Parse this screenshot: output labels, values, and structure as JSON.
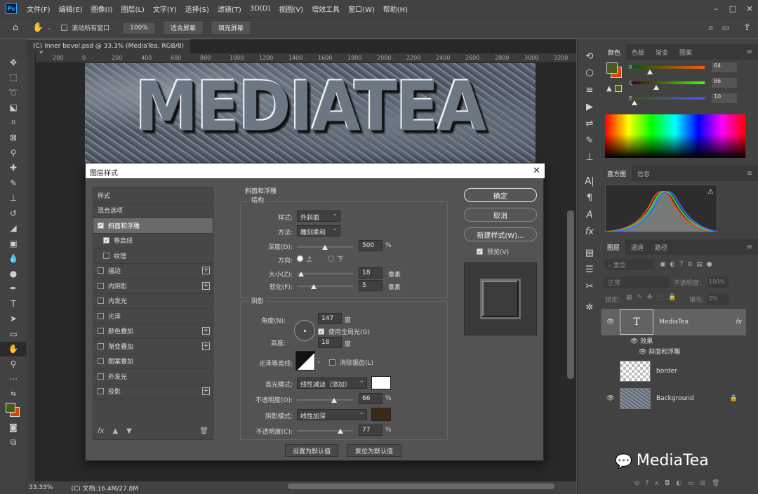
{
  "menu": {
    "items": [
      "文件(F)",
      "编辑(E)",
      "图像(I)",
      "图层(L)",
      "文字(Y)",
      "选择(S)",
      "滤镜(T)",
      "3D(D)",
      "视图(V)",
      "增效工具",
      "窗口(W)",
      "帮助(H)"
    ]
  },
  "options": {
    "scroll_all": "滚动所有窗口",
    "zoom_100": "100%",
    "fit_screen": "适合屏幕",
    "fill_screen": "填充屏幕"
  },
  "document": {
    "tab_title": "(C) Inner bevel.psd @ 33.3% (MediaTea, RGB/8)",
    "ruler_ticks": [
      "200",
      "0",
      "200",
      "400",
      "600",
      "800",
      "1000",
      "1200",
      "1400",
      "1600",
      "1800",
      "2000",
      "2200",
      "2400",
      "2600",
      "2800",
      "3000",
      "3200"
    ],
    "canvas_text": "MEDIATEA",
    "zoom": "33.33%",
    "doc_info": "(C) 文档:16.4M/27.8M"
  },
  "dialog": {
    "title": "图层样式",
    "styles_header": "样式",
    "blend_options": "混合选项",
    "effects": [
      {
        "label": "斜面和浮雕",
        "checked": true,
        "selected": true,
        "plus": false,
        "indent": false
      },
      {
        "label": "等高线",
        "checked": true,
        "selected": false,
        "plus": false,
        "indent": true
      },
      {
        "label": "纹理",
        "checked": false,
        "selected": false,
        "plus": false,
        "indent": true
      },
      {
        "label": "描边",
        "checked": false,
        "selected": false,
        "plus": true,
        "indent": false
      },
      {
        "label": "内阴影",
        "checked": false,
        "selected": false,
        "plus": true,
        "indent": false
      },
      {
        "label": "内发光",
        "checked": false,
        "selected": false,
        "plus": false,
        "indent": false
      },
      {
        "label": "光泽",
        "checked": false,
        "selected": false,
        "plus": false,
        "indent": false
      },
      {
        "label": "颜色叠加",
        "checked": false,
        "selected": false,
        "plus": true,
        "indent": false
      },
      {
        "label": "渐变叠加",
        "checked": false,
        "selected": false,
        "plus": true,
        "indent": false
      },
      {
        "label": "图案叠加",
        "checked": false,
        "selected": false,
        "plus": false,
        "indent": false
      },
      {
        "label": "外发光",
        "checked": false,
        "selected": false,
        "plus": false,
        "indent": false
      },
      {
        "label": "投影",
        "checked": false,
        "selected": false,
        "plus": true,
        "indent": false
      }
    ],
    "section_title": "斜面和浮雕",
    "structure": {
      "title": "结构",
      "style_label": "样式:",
      "style_value": "外斜面",
      "technique_label": "方法:",
      "technique_value": "雕刻柔和",
      "depth_label": "深度(D):",
      "depth_value": "500",
      "depth_unit": "%",
      "depth_fraction": 0.5,
      "direction_label": "方向:",
      "dir_up": "上",
      "dir_down": "下",
      "size_label": "大小(Z):",
      "size_value": "18",
      "size_unit": "像素",
      "size_fraction": 0.07,
      "soften_label": "软化(F):",
      "soften_value": "5",
      "soften_unit": "像素",
      "soften_fraction": 0.3
    },
    "shading": {
      "title": "阴影",
      "angle_label": "角度(N):",
      "angle_value": "147",
      "angle_unit": "度",
      "global_light": "使用全局光(G)",
      "altitude_label": "高度:",
      "altitude_value": "18",
      "altitude_unit": "度",
      "gloss_label": "光泽等高线:",
      "antialias": "消除锯齿(L)",
      "highlight_label": "高光模式:",
      "highlight_mode": "线性减淡（添加）",
      "highlight_color": "#ffffff",
      "hl_opacity_label": "不透明度(O):",
      "hl_opacity_value": "66",
      "hl_opacity_fraction": 0.66,
      "shadow_label": "阴影模式:",
      "shadow_mode": "线性加深",
      "shadow_color": "#3b2a16",
      "sh_opacity_label": "不透明度(C):",
      "sh_opacity_value": "77",
      "sh_opacity_fraction": 0.77,
      "pct": "%"
    },
    "set_default": "设置为默认值",
    "reset_default": "复位为默认值",
    "ok": "确定",
    "cancel": "取消",
    "new_style": "新建样式(W)...",
    "preview": "预览(V)"
  },
  "color_panel": {
    "tabs": [
      "颜色",
      "色板",
      "渐变",
      "图案"
    ],
    "foreground": "#4a5a1a",
    "background": "#d3440f",
    "r_value": "64",
    "g_value": "86",
    "b_value": "10",
    "r_fraction": 0.25,
    "g_fraction": 0.34,
    "b_fraction": 0.04
  },
  "histogram_panel": {
    "tabs": [
      "直方图",
      "信息"
    ]
  },
  "layers_panel": {
    "tabs": [
      "图层",
      "通道",
      "路径"
    ],
    "filter_placeholder": "类型",
    "blend_mode": "正常",
    "opacity_label": "不透明度:",
    "opacity_value": "100%",
    "lock_label": "锁定:",
    "fill_label": "填充:",
    "fill_value": "0%",
    "layers": [
      {
        "name": "MediaTea",
        "type": "text",
        "fx": "fx",
        "visible": true
      },
      {
        "name": "border",
        "type": "raster",
        "fx": "",
        "visible": false
      },
      {
        "name": "Background",
        "type": "background",
        "fx": "",
        "visible": true
      }
    ],
    "effects_label": "效果",
    "effect_item": "斜面和浮雕"
  },
  "watermark": "MediaTea"
}
